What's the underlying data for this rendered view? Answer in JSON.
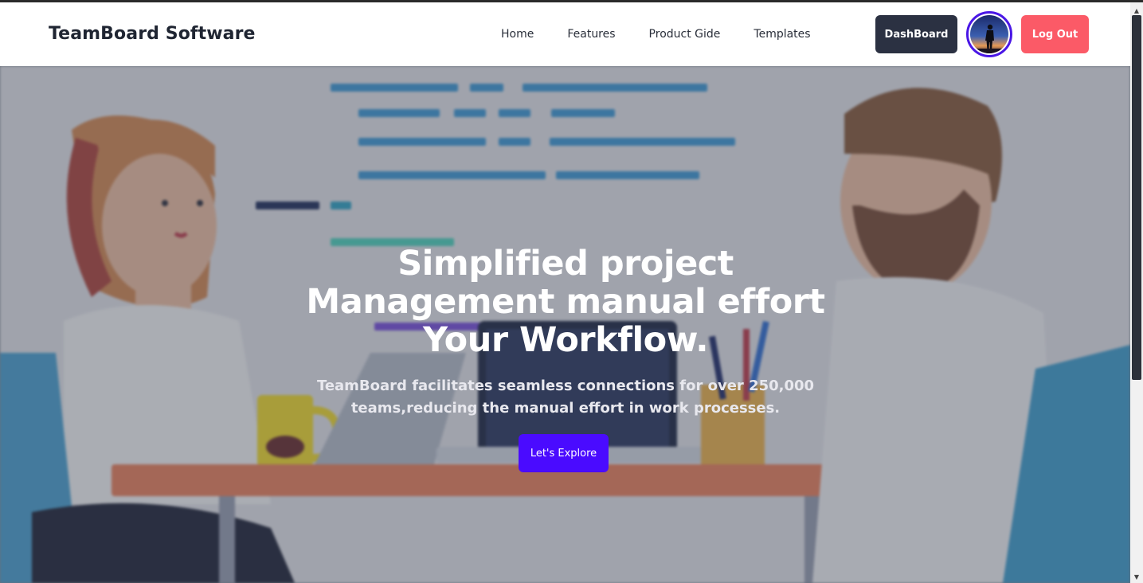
{
  "navbar": {
    "brand": "TeamBoard Software",
    "links": [
      {
        "label": "Home"
      },
      {
        "label": "Features"
      },
      {
        "label": "Product Gide"
      },
      {
        "label": "Templates"
      }
    ],
    "dashboard_label": "DashBoard",
    "logout_label": "Log Out"
  },
  "hero": {
    "title": "Simplified project\nManagement manual effort\nYour Workflow.",
    "subtitle": "TeamBoard facilitates seamless connections for over 250,000\nteams,reducing the manual effort in work processes.",
    "cta_label": "Let's Explore"
  },
  "colors": {
    "accent": "#4a0bff",
    "dark_button": "#2b3142",
    "logout_button": "#fb5a67",
    "avatar_ring": "#4a17e6"
  },
  "icons": {
    "avatar": "user-avatar-icon",
    "scroll_up": "scroll-up-arrow-icon",
    "scroll_down": "scroll-down-arrow-icon"
  }
}
